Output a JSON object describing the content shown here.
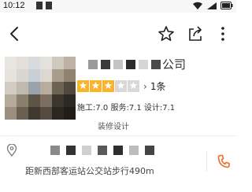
{
  "status_bar": {
    "time": "10:12",
    "icons": [
      "wifi-icon",
      "signal-icon",
      "battery-icon"
    ]
  },
  "nav": {
    "icons": [
      "back-icon",
      "star-favorite-icon",
      "share-icon",
      "more-icon"
    ]
  },
  "shop": {
    "name_visible_suffix": "公司",
    "rating": {
      "stars_filled": 3,
      "stars_total": 5,
      "reviews": "1条"
    },
    "sub_scores": "施工:7.0 服务:7.1 设计:7.1",
    "category": "装修设计"
  },
  "address": {
    "distance": "距新西部客运站公交站步行490m"
  },
  "colors": {
    "accent_star": "#f7b52c",
    "star_empty": "#d8d8d8",
    "phone_accent": "#ef6a2a"
  }
}
